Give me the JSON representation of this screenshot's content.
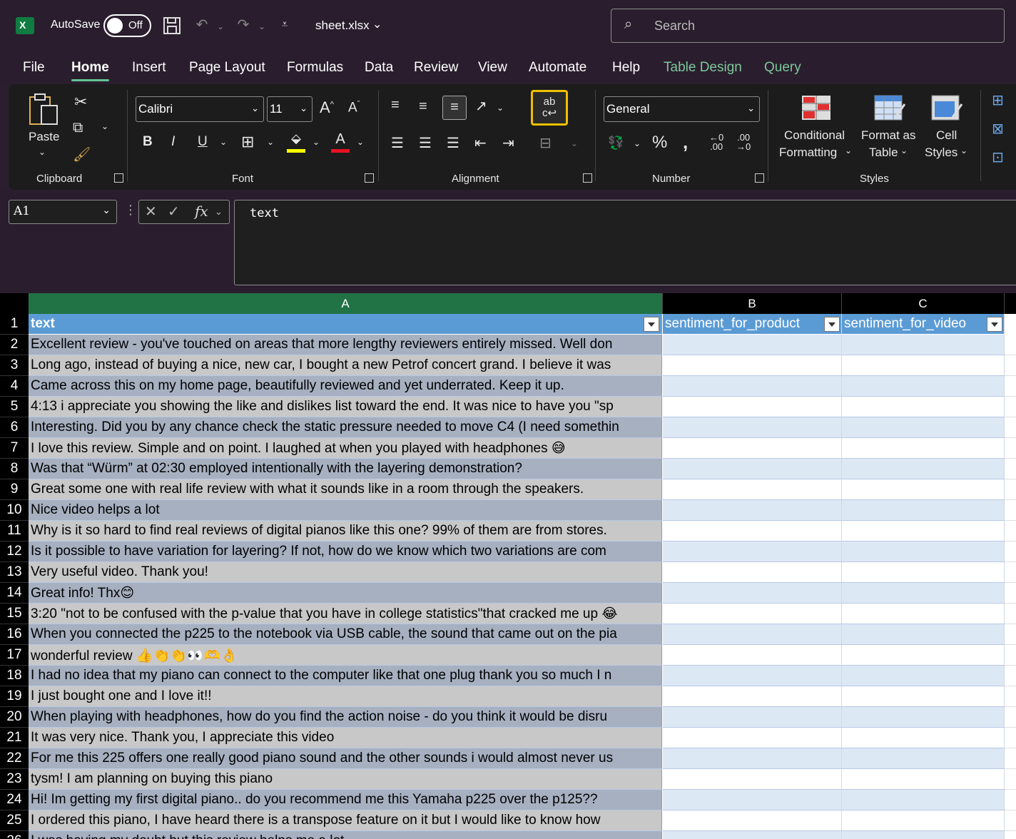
{
  "titlebar": {
    "app_logo": "X",
    "autosave_label": "AutoSave",
    "autosave_state": "Off",
    "filename": "sheet.xlsx",
    "search_placeholder": "Search"
  },
  "menu": {
    "tabs": [
      "File",
      "Home",
      "Insert",
      "Page Layout",
      "Formulas",
      "Data",
      "Review",
      "View",
      "Automate",
      "Help",
      "Table Design",
      "Query"
    ],
    "active": "Home"
  },
  "ribbon": {
    "clipboard": {
      "label": "Clipboard",
      "paste": "Paste"
    },
    "font": {
      "label": "Font",
      "name": "Calibri",
      "size": "11"
    },
    "alignment": {
      "label": "Alignment"
    },
    "number": {
      "label": "Number",
      "format": "General"
    },
    "styles": {
      "label": "Styles",
      "conditional_1": "Conditional",
      "conditional_2": "Formatting",
      "format_table_1": "Format as",
      "format_table_2": "Table",
      "cell_styles_1": "Cell",
      "cell_styles_2": "Styles"
    }
  },
  "formula_bar": {
    "name_box": "A1",
    "content": "text"
  },
  "sheet": {
    "columns": [
      "A",
      "B",
      "C"
    ],
    "header": [
      "text",
      "sentiment_for_product",
      "sentiment_for_video"
    ],
    "rows": [
      "Excellent review - you've touched on areas that more lengthy reviewers entirely missed. Well don",
      "Long ago, instead of buying a nice, new car, I bought a new Petrof concert grand.  I believe it was ",
      "Came across this on my home page, beautifully reviewed and yet underrated. Keep it up.",
      "4:13 i appreciate you showing the like and dislikes list toward the end. It was nice to have you \"sp",
      "Interesting. Did you by any chance check the static pressure needed to move C4 (I need somethin",
      "I love this review. Simple and on point. I laughed at when you played with headphones 😅",
      "Was that “Würm” at 02:30 employed intentionally with the layering demonstration?",
      "Great some one with real life review with what it sounds like in a room through the speakers.",
      "Nice video helps a lot",
      "Why is it so hard to find real reviews of digital pianos like this one? 99% of them are from stores.",
      "Is it possible to have variation for layering? If not, how do we know which two variations are com",
      "Very useful video. Thank you!",
      "Great info!  Thx😊",
      "3:20 \"not to be confused with the p-value that you have in college statistics\"that cracked me up 😂",
      "When you connected the p225 to the notebook via USB cable, the sound that came out on the pia",
      "wonderful review 👍👏👏👀🫶👌",
      "I had no idea that my piano can connect to the computer like that one plug thank you so much I n",
      "I just bought one and I love it!!",
      "When playing with headphones, how do you find the action noise - do you think it would be disru",
      "It was very nice. Thank you, I appreciate this video",
      "For me this 225 offers one really good piano sound and the other sounds i would almost never us",
      "tysm! I am planning on buying this piano",
      "Hi! Im getting my first digital piano.. do you recommend me this Yamaha p225 over the p125??",
      "I ordered this piano, I have heard there is a transpose feature on it but I would like to know how ",
      "I was having my doubt but this review helps me a lot"
    ]
  }
}
